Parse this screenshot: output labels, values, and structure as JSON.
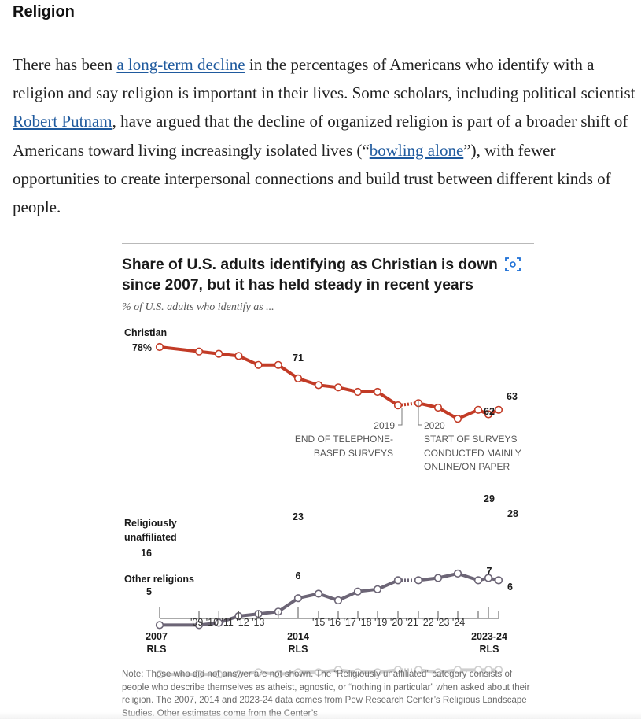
{
  "section": {
    "heading": "Religion"
  },
  "paragraph": {
    "t1": "There has been ",
    "link1": "a long-term decline",
    "t2": " in the percentages of Americans who identify with a religion and say religion is important in their lives. Some scholars, including political scientist ",
    "link2": "Robert Putnam",
    "t3": ", have argued that the decline of organized religion is part of a broader shift of Americans toward living increasingly isolated lives (“",
    "link3": "bowling alone",
    "t4": "”), with fewer opportunities to create interpersonal connections and build trust between different kinds of people."
  },
  "chart": {
    "title": "Share of U.S. adults identifying as Christian is down since 2007, but it has held steady in recent years",
    "subtitle": "% of U.S. adults who identify as ...",
    "note": "Note: Those who did not answer are not shown. The “Religiously unaffiliated” category consists of people who describe themselves as atheist, agnostic, or “nothing in particular” when asked about their religion. The 2007, 2014 and 2023-24 data comes from Pew Research Center’s Religious Landscape Studies. Other estimates come from the Center’s",
    "annotations": {
      "a2019": {
        "year": "2019",
        "l1": "END OF TELEPHONE-",
        "l2": "BASED SURVEYS"
      },
      "a2020": {
        "year": "2020",
        "l1": "START OF SURVEYS",
        "l2": "CONDUCTED MAINLY",
        "l3": "ONLINE/ON PAPER"
      }
    },
    "icon": "expand-icon",
    "colors": {
      "christian": "#c23b26",
      "unaffiliated": "#6c6576",
      "other": "#cfcfcf"
    }
  },
  "chart_data": {
    "type": "line",
    "title": "Share of U.S. adults identifying as Christian is down since 2007, but it has held steady in recent years",
    "subtitle": "% of U.S. adults who identify as ...",
    "x_axis": {
      "range": [
        2007,
        2024
      ],
      "ticks": [
        {
          "x": 2007,
          "label": "2007",
          "sub": "RLS",
          "major": true
        },
        {
          "x": 2009,
          "label": "'09"
        },
        {
          "x": 2010,
          "label": "'10"
        },
        {
          "x": 2011,
          "label": "'11"
        },
        {
          "x": 2012,
          "label": "'12"
        },
        {
          "x": 2013,
          "label": "'13"
        },
        {
          "x": 2014,
          "label": "2014",
          "sub": "RLS",
          "major": true
        },
        {
          "x": 2015,
          "label": "'15"
        },
        {
          "x": 2016,
          "label": "'16"
        },
        {
          "x": 2017,
          "label": "'17"
        },
        {
          "x": 2018,
          "label": "'18"
        },
        {
          "x": 2019,
          "label": "'19"
        },
        {
          "x": 2020,
          "label": "'20"
        },
        {
          "x": 2021,
          "label": "'21"
        },
        {
          "x": 2022,
          "label": "'22"
        },
        {
          "x": 2023,
          "label": "'23"
        },
        {
          "x": 2024,
          "label": "'24"
        },
        {
          "x": 2023.5,
          "label": "2023-24",
          "sub": "RLS",
          "major": true
        }
      ]
    },
    "series": [
      {
        "name": "Christian",
        "start_label": "78%",
        "points": [
          {
            "x": 2007,
            "y": 78
          },
          {
            "x": 2009,
            "y": 77
          },
          {
            "x": 2010,
            "y": 76.5
          },
          {
            "x": 2011,
            "y": 76
          },
          {
            "x": 2012,
            "y": 74
          },
          {
            "x": 2013,
            "y": 74
          },
          {
            "x": 2014,
            "y": 71
          },
          {
            "x": 2015,
            "y": 69.5
          },
          {
            "x": 2016,
            "y": 69
          },
          {
            "x": 2017,
            "y": 68
          },
          {
            "x": 2018,
            "y": 68
          },
          {
            "x": 2019,
            "y": 65
          },
          {
            "x": 2020,
            "y": 65.5
          },
          {
            "x": 2021,
            "y": 64.5
          },
          {
            "x": 2022,
            "y": 62
          },
          {
            "x": 2023,
            "y": 64
          },
          {
            "x": 2023.5,
            "y": 63
          },
          {
            "x": 2024,
            "y": 64
          }
        ],
        "value_labels": [
          {
            "x": 2014,
            "text": "71"
          },
          {
            "x": 2022,
            "text": "62"
          },
          {
            "x": 2024,
            "text": "63"
          }
        ]
      },
      {
        "name": "Religiously unaffiliated",
        "start_label": "16",
        "points": [
          {
            "x": 2007,
            "y": 16
          },
          {
            "x": 2009,
            "y": 16
          },
          {
            "x": 2010,
            "y": 16.5
          },
          {
            "x": 2011,
            "y": 18
          },
          {
            "x": 2012,
            "y": 18.5
          },
          {
            "x": 2013,
            "y": 19
          },
          {
            "x": 2014,
            "y": 22
          },
          {
            "x": 2015,
            "y": 23
          },
          {
            "x": 2016,
            "y": 21.5
          },
          {
            "x": 2017,
            "y": 23.5
          },
          {
            "x": 2018,
            "y": 24
          },
          {
            "x": 2019,
            "y": 26
          },
          {
            "x": 2020,
            "y": 26
          },
          {
            "x": 2021,
            "y": 26.5
          },
          {
            "x": 2022,
            "y": 27.5
          },
          {
            "x": 2023,
            "y": 26
          },
          {
            "x": 2023.5,
            "y": 26.5
          },
          {
            "x": 2024,
            "y": 26
          }
        ],
        "value_labels": [
          {
            "x": 2014,
            "text": "23"
          },
          {
            "x": 2022,
            "text": "29"
          },
          {
            "x": 2024,
            "text": "28"
          }
        ]
      },
      {
        "name": "Other religions",
        "start_label": "5",
        "points": [
          {
            "x": 2007,
            "y": 5
          },
          {
            "x": 2009,
            "y": 5
          },
          {
            "x": 2010,
            "y": 5
          },
          {
            "x": 2011,
            "y": 5
          },
          {
            "x": 2012,
            "y": 5.5
          },
          {
            "x": 2013,
            "y": 5
          },
          {
            "x": 2014,
            "y": 5.5
          },
          {
            "x": 2015,
            "y": 5.5
          },
          {
            "x": 2016,
            "y": 6
          },
          {
            "x": 2017,
            "y": 5.5
          },
          {
            "x": 2018,
            "y": 5.5
          },
          {
            "x": 2019,
            "y": 6
          },
          {
            "x": 2020,
            "y": 6
          },
          {
            "x": 2021,
            "y": 5.5
          },
          {
            "x": 2022,
            "y": 6
          },
          {
            "x": 2023,
            "y": 6
          },
          {
            "x": 2023.5,
            "y": 6
          },
          {
            "x": 2024,
            "y": 6
          }
        ],
        "value_labels": [
          {
            "x": 2014,
            "text": "6"
          },
          {
            "x": 2022,
            "text": "7"
          },
          {
            "x": 2024,
            "text": "6"
          }
        ]
      }
    ]
  }
}
